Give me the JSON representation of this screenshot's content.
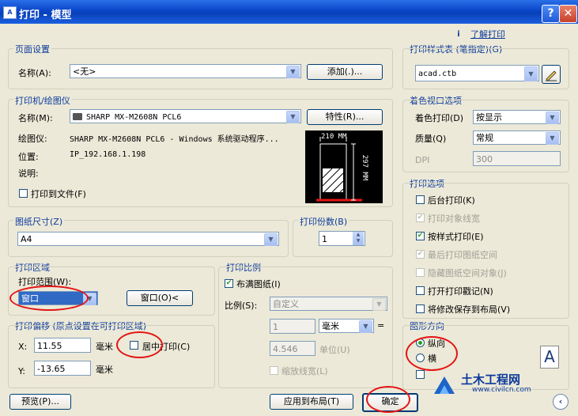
{
  "window": {
    "title": "打印 - 模型",
    "icon": "A",
    "help": "?",
    "close": "✕"
  },
  "help_link": {
    "icon": "i",
    "label": "了解打印"
  },
  "page_setup": {
    "legend": "页面设置",
    "name_label": "名称(A):",
    "name_value": "<无>",
    "add_button": "添加(.)..."
  },
  "printer": {
    "legend": "打印机/绘图仪",
    "name_label": "名称(M):",
    "name_value": "SHARP MX-M2608N PCL6",
    "properties_button": "特性(R)...",
    "plotter_label": "绘图仪:",
    "plotter_value": "SHARP MX-M2608N PCL6 - Windows 系统驱动程序...",
    "location_label": "位置:",
    "location_value": "IP_192.168.1.198",
    "desc_label": "说明:",
    "print_to_file": "打印到文件(F)",
    "preview_width": "210 MM",
    "preview_height": "297 MM"
  },
  "paper_size": {
    "legend": "图纸尺寸(Z)",
    "value": "A4"
  },
  "copies": {
    "legend": "打印份数(B)",
    "value": "1"
  },
  "print_area": {
    "legend": "打印区域",
    "range_label": "打印范围(W):",
    "range_value": "窗口",
    "window_button": "窗口(O)<"
  },
  "print_offset": {
    "legend": "打印偏移 (原点设置在可打印区域)",
    "x_label": "X:",
    "x_value": "11.55",
    "x_unit": "毫米",
    "y_label": "Y:",
    "y_value": "-13.65",
    "y_unit": "毫米",
    "center_label": "居中打印(C)"
  },
  "print_scale": {
    "legend": "打印比例",
    "fit_label": "布满图纸(I)",
    "scale_label": "比例(S):",
    "scale_value": "自定义",
    "value1": "1",
    "unit1": "毫米",
    "equals": "=",
    "value2": "4.546",
    "unit2": "单位(U)",
    "lineweight_label": "缩放线宽(L)"
  },
  "plot_style": {
    "legend": "打印样式表 (笔指定)(G)",
    "value": "acad.ctb"
  },
  "shaded": {
    "legend": "着色视口选项",
    "shade_label": "着色打印(D)",
    "shade_value": "按显示",
    "quality_label": "质量(Q)",
    "quality_value": "常规",
    "dpi_label": "DPI",
    "dpi_value": "300"
  },
  "options": {
    "legend": "打印选项",
    "items": [
      {
        "label": "后台打印(K)"
      },
      {
        "label": "打印对象线宽"
      },
      {
        "label": "按样式打印(E)"
      },
      {
        "label": "最后打印图纸空间"
      },
      {
        "label": "隐藏图纸空间对象(J)"
      },
      {
        "label": "打开打印戳记(N)"
      },
      {
        "label": "将修改保存到布局(V)"
      }
    ]
  },
  "orientation": {
    "legend": "图形方向",
    "portrait": "纵向",
    "landscape": "横",
    "letter": "A"
  },
  "footer": {
    "preview_button": "预览(P)...",
    "apply_button": "应用到布局(T)",
    "ok_button": "确定",
    "more_icon": "‹"
  },
  "watermark": {
    "brand": "土木工程网",
    "url": "www.civilcn.com"
  },
  "colors": {
    "annotation": "#e41414",
    "title_bar": "#0a46c8",
    "check_green": "#21a121"
  }
}
